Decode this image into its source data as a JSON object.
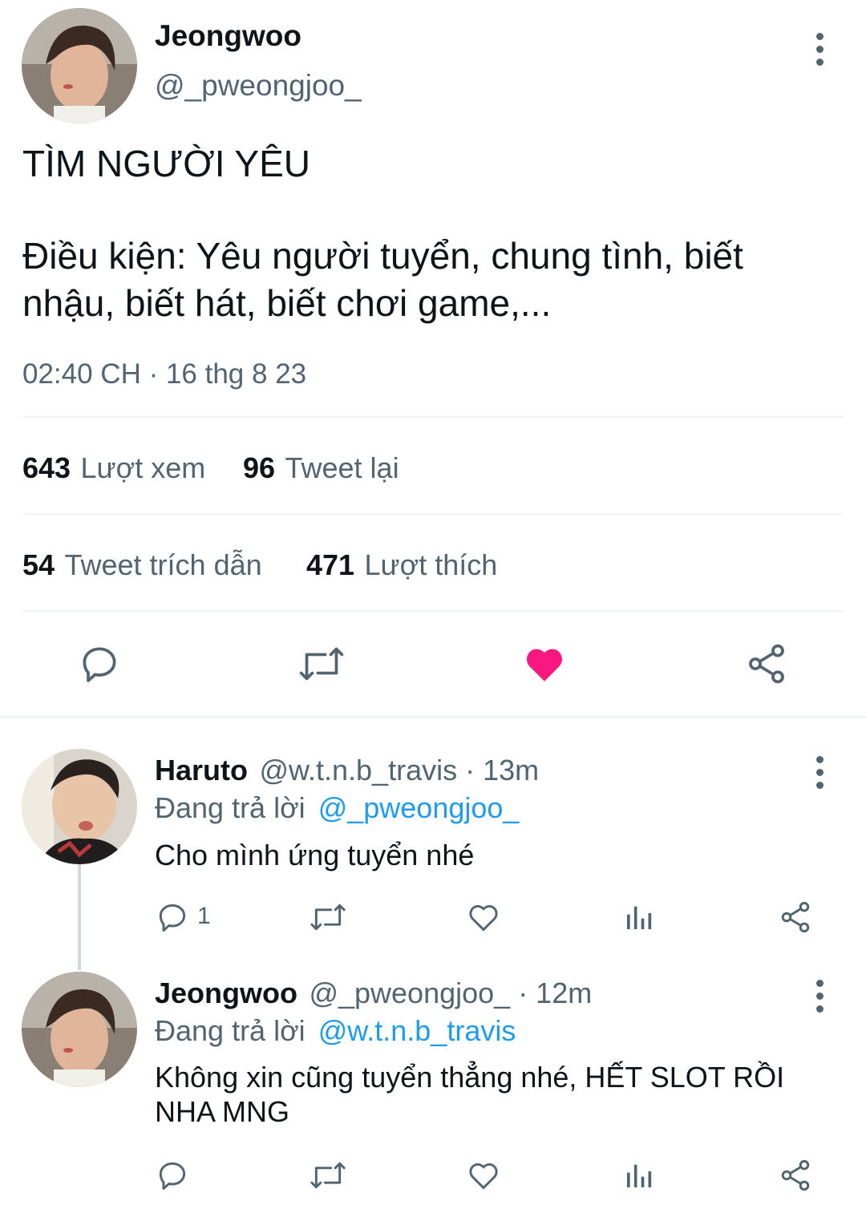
{
  "main_tweet": {
    "author_name": "Jeongwoo",
    "author_handle": "@_pweongjoo_",
    "text_line1": "TÌM NGƯỜI YÊU",
    "text_line2": "Điều kiện: Yêu người tuyển, chung tình, biết",
    "text_line3": "nhậu, biết hát, biết chơi game,...",
    "timestamp": "02:40 CH · 16 thg 8 23",
    "stats": {
      "views_num": "643",
      "views_label": "Lượt xem",
      "retweets_num": "96",
      "retweets_label": "Tweet lại",
      "quotes_num": "54",
      "quotes_label": "Tweet trích dẫn",
      "likes_num": "471",
      "likes_label": "Lượt thích"
    },
    "liked": true,
    "icons": [
      "reply-icon",
      "retweet-icon",
      "like-icon",
      "share-icon"
    ]
  },
  "replies": [
    {
      "author_name": "Haruto",
      "author_handle": "@w.t.n.b_travis · 13m",
      "replying_prefix": "Đang trả lời",
      "replying_to": "@_pweongjoo_",
      "text_line1": "Cho mình ứng tuyển nhé",
      "text_line2": "",
      "reply_count": "1"
    },
    {
      "author_name": "Jeongwoo",
      "author_handle": "@_pweongjoo_ · 12m",
      "replying_prefix": "Đang trả lời",
      "replying_to": "@w.t.n.b_travis",
      "text_line1": "Không xin cũng tuyển thẳng nhé, HẾT SLOT RỒI",
      "text_line2": "NHA MNG",
      "reply_count": ""
    }
  ],
  "colors": {
    "like_red": "#f91880",
    "mention_blue": "#1d9bf0",
    "secondary_text": "#536471",
    "divider": "#eff3f4"
  }
}
